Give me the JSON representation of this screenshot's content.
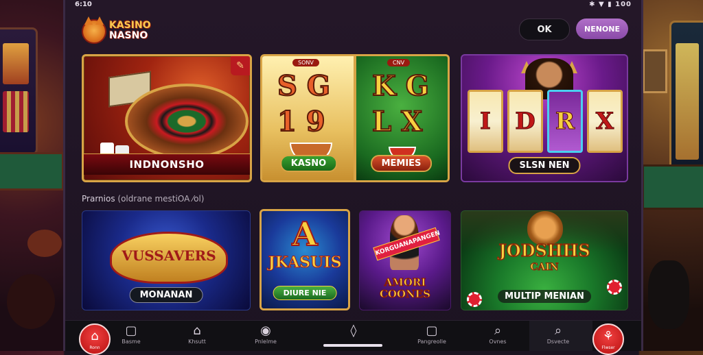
{
  "status": {
    "time": "6:10",
    "icons": "✱ ▼ ▮ 100"
  },
  "header": {
    "logo_line1": "KASINO",
    "logo_line2": "NASNO",
    "ok_label": "OK",
    "menu_label": "NENONE"
  },
  "featured": [
    {
      "label": "INDNONSHO",
      "corner": "✎"
    },
    {
      "tag_left": "SONV",
      "tag_right": "CNV",
      "sym_a": "S",
      "sym_b": "G",
      "sym_c": "1",
      "sym_d": "9",
      "sym_e": "K",
      "sym_f": "G",
      "sym_g": "L",
      "sym_h": "X",
      "label_left": "KASNO",
      "label_right": "MEMIES"
    },
    {
      "reels": [
        "I",
        "D",
        "R",
        "X"
      ],
      "label": "SLSN NEN"
    }
  ],
  "section": {
    "title": "Prarnios",
    "subtitle": "(oldrane mestiOA ⁄ol)"
  },
  "games": [
    {
      "art": "VUSSAVERS",
      "label": "MONANAN"
    },
    {
      "art_big": "A",
      "art_small": "JKASUIS",
      "label": "DIURE NIE"
    },
    {
      "art_sash": "KORGUANAPANGEN",
      "art_title": "AMORI\nCOONES"
    },
    {
      "art_title": "JODSHHS",
      "art_sub": "CAIN",
      "label": "MULTIP MENIAN"
    }
  ],
  "nav": [
    {
      "icon": "⌂",
      "label": "Ronn"
    },
    {
      "icon": "▢",
      "label": "Basme"
    },
    {
      "icon": "⌂",
      "label": "Khsutt"
    },
    {
      "icon": "◉",
      "label": "Pnlelme"
    },
    {
      "icon": "◊",
      "label": ""
    },
    {
      "icon": "▢",
      "label": "Pangreolle"
    },
    {
      "icon": "⌕",
      "label": "Ovnes"
    },
    {
      "icon": "⌕",
      "label": "Dsvecte"
    },
    {
      "icon": "⚘",
      "label": "Flwser"
    }
  ]
}
